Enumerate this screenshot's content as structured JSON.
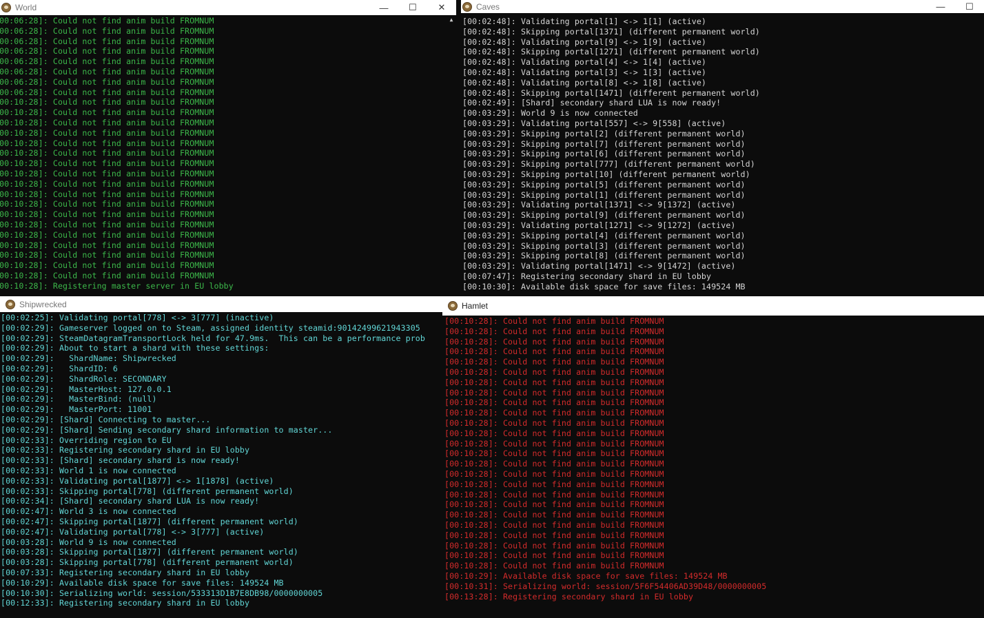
{
  "world": {
    "title": "World",
    "lines": [
      "00:06:28]: Could not find anim build FROMNUM",
      "00:06:28]: Could not find anim build FROMNUM",
      "00:06:28]: Could not find anim build FROMNUM",
      "00:06:28]: Could not find anim build FROMNUM",
      "00:06:28]: Could not find anim build FROMNUM",
      "00:06:28]: Could not find anim build FROMNUM",
      "00:06:28]: Could not find anim build FROMNUM",
      "00:06:28]: Could not find anim build FROMNUM",
      "00:10:28]: Could not find anim build FROMNUM",
      "00:10:28]: Could not find anim build FROMNUM",
      "00:10:28]: Could not find anim build FROMNUM",
      "00:10:28]: Could not find anim build FROMNUM",
      "00:10:28]: Could not find anim build FROMNUM",
      "00:10:28]: Could not find anim build FROMNUM",
      "00:10:28]: Could not find anim build FROMNUM",
      "00:10:28]: Could not find anim build FROMNUM",
      "00:10:28]: Could not find anim build FROMNUM",
      "00:10:28]: Could not find anim build FROMNUM",
      "00:10:28]: Could not find anim build FROMNUM",
      "00:10:28]: Could not find anim build FROMNUM",
      "00:10:28]: Could not find anim build FROMNUM",
      "00:10:28]: Could not find anim build FROMNUM",
      "00:10:28]: Could not find anim build FROMNUM",
      "00:10:28]: Could not find anim build FROMNUM",
      "00:10:28]: Could not find anim build FROMNUM",
      "00:10:28]: Could not find anim build FROMNUM",
      "00:10:28]: Registering master server in EU lobby"
    ]
  },
  "caves": {
    "title": "Caves",
    "lines": [
      "[00:02:48]: Validating portal[1] <-> 1[1] (active)",
      "[00:02:48]: Skipping portal[1371] (different permanent world)",
      "[00:02:48]: Validating portal[9] <-> 1[9] (active)",
      "[00:02:48]: Skipping portal[1271] (different permanent world)",
      "[00:02:48]: Validating portal[4] <-> 1[4] (active)",
      "[00:02:48]: Validating portal[3] <-> 1[3] (active)",
      "[00:02:48]: Validating portal[8] <-> 1[8] (active)",
      "[00:02:48]: Skipping portal[1471] (different permanent world)",
      "[00:02:49]: [Shard] secondary shard LUA is now ready!",
      "[00:03:29]: World 9 is now connected",
      "[00:03:29]: Validating portal[557] <-> 9[558] (active)",
      "[00:03:29]: Skipping portal[2] (different permanent world)",
      "[00:03:29]: Skipping portal[7] (different permanent world)",
      "[00:03:29]: Skipping portal[6] (different permanent world)",
      "[00:03:29]: Skipping portal[777] (different permanent world)",
      "[00:03:29]: Skipping portal[10] (different permanent world)",
      "[00:03:29]: Skipping portal[5] (different permanent world)",
      "[00:03:29]: Skipping portal[1] (different permanent world)",
      "[00:03:29]: Validating portal[1371] <-> 9[1372] (active)",
      "[00:03:29]: Skipping portal[9] (different permanent world)",
      "[00:03:29]: Validating portal[1271] <-> 9[1272] (active)",
      "[00:03:29]: Skipping portal[4] (different permanent world)",
      "[00:03:29]: Skipping portal[3] (different permanent world)",
      "[00:03:29]: Skipping portal[8] (different permanent world)",
      "[00:03:29]: Validating portal[1471] <-> 9[1472] (active)",
      "[00:07:47]: Registering secondary shard in EU lobby",
      "[00:10:30]: Available disk space for save files: 149524 MB"
    ]
  },
  "shipwrecked": {
    "title": "Shipwrecked",
    "lines": [
      "[00:02:25]: Validating portal[778] <-> 3[777] (inactive)",
      "[00:02:29]: Gameserver logged on to Steam, assigned identity steamid:90142499621943305",
      "[00:02:29]: SteamDatagramTransportLock held for 47.9ms.  This can be a performance prob",
      "[00:02:29]: About to start a shard with these settings:",
      "[00:02:29]:   ShardName: Shipwrecked",
      "[00:02:29]:   ShardID: 6",
      "[00:02:29]:   ShardRole: SECONDARY",
      "[00:02:29]:   MasterHost: 127.0.0.1",
      "[00:02:29]:   MasterBind: (null)",
      "[00:02:29]:   MasterPort: 11001",
      "[00:02:29]: [Shard] Connecting to master...",
      "[00:02:29]: [Shard] Sending secondary shard information to master...",
      "[00:02:33]: Overriding region to EU",
      "[00:02:33]: Registering secondary shard in EU lobby",
      "[00:02:33]: [Shard] secondary shard is now ready!",
      "[00:02:33]: World 1 is now connected",
      "[00:02:33]: Validating portal[1877] <-> 1[1878] (active)",
      "[00:02:33]: Skipping portal[778] (different permanent world)",
      "[00:02:34]: [Shard] secondary shard LUA is now ready!",
      "[00:02:47]: World 3 is now connected",
      "[00:02:47]: Skipping portal[1877] (different permanent world)",
      "[00:02:47]: Validating portal[778] <-> 3[777] (active)",
      "[00:03:28]: World 9 is now connected",
      "[00:03:28]: Skipping portal[1877] (different permanent world)",
      "[00:03:28]: Skipping portal[778] (different permanent world)",
      "[00:07:33]: Registering secondary shard in EU lobby",
      "[00:10:29]: Available disk space for save files: 149524 MB",
      "[00:10:30]: Serializing world: session/533313D1B7E8DB98/0000000005",
      "[00:12:33]: Registering secondary shard in EU lobby"
    ]
  },
  "hamlet": {
    "title": "Hamlet",
    "lines": [
      "[00:10:28]: Could not find anim build FROMNUM",
      "[00:10:28]: Could not find anim build FROMNUM",
      "[00:10:28]: Could not find anim build FROMNUM",
      "[00:10:28]: Could not find anim build FROMNUM",
      "[00:10:28]: Could not find anim build FROMNUM",
      "[00:10:28]: Could not find anim build FROMNUM",
      "[00:10:28]: Could not find anim build FROMNUM",
      "[00:10:28]: Could not find anim build FROMNUM",
      "[00:10:28]: Could not find anim build FROMNUM",
      "[00:10:28]: Could not find anim build FROMNUM",
      "[00:10:28]: Could not find anim build FROMNUM",
      "[00:10:28]: Could not find anim build FROMNUM",
      "[00:10:28]: Could not find anim build FROMNUM",
      "[00:10:28]: Could not find anim build FROMNUM",
      "[00:10:28]: Could not find anim build FROMNUM",
      "[00:10:28]: Could not find anim build FROMNUM",
      "[00:10:28]: Could not find anim build FROMNUM",
      "[00:10:28]: Could not find anim build FROMNUM",
      "[00:10:28]: Could not find anim build FROMNUM",
      "[00:10:28]: Could not find anim build FROMNUM",
      "[00:10:28]: Could not find anim build FROMNUM",
      "[00:10:28]: Could not find anim build FROMNUM",
      "[00:10:28]: Could not find anim build FROMNUM",
      "[00:10:28]: Could not find anim build FROMNUM",
      "[00:10:28]: Could not find anim build FROMNUM",
      "[00:10:29]: Available disk space for save files: 149524 MB",
      "[00:10:31]: Serializing world: session/5F6F54406AD39D48/0000000005",
      "[00:13:28]: Registering secondary shard in EU lobby"
    ]
  },
  "controls": {
    "minimize": "—",
    "maximize": "☐",
    "close": "✕",
    "scroll_up": "▲"
  },
  "colors": {
    "world_text": "#3cb84a",
    "caves_text": "#d6d6d6",
    "shipwrecked_text": "#61d6d6",
    "hamlet_text": "#d42b2b"
  }
}
